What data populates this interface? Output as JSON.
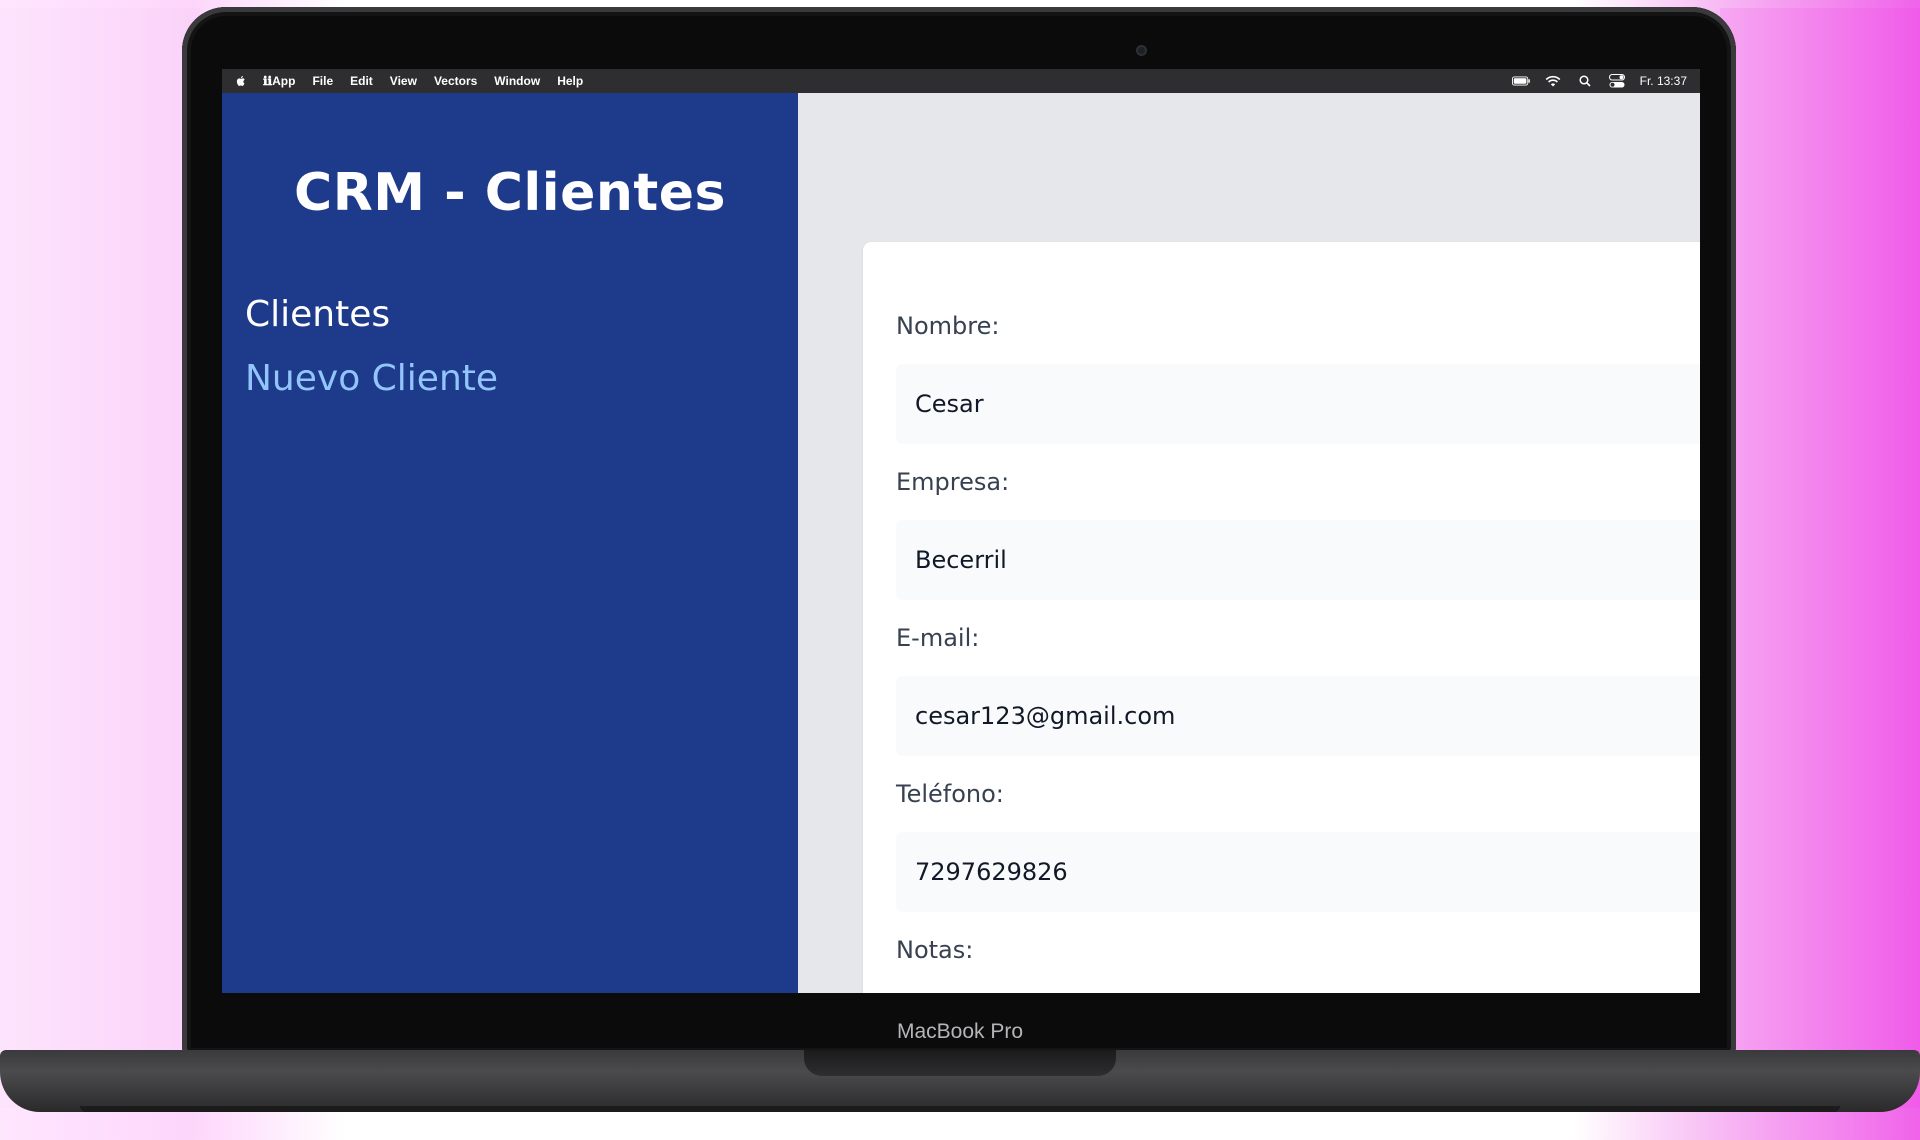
{
  "menubar": {
    "apple_icon": "apple-logo-icon",
    "items": [
      "𝐢𝐢App",
      "File",
      "Edit",
      "View",
      "Vectors",
      "Window",
      "Help"
    ],
    "app_name": "ℹℹApp",
    "file": "File",
    "edit": "Edit",
    "view": "View",
    "vectors": "Vectors",
    "window": "Window",
    "help": "Help",
    "clock": "Fr. 13:37",
    "status_icons": [
      "battery-icon",
      "wifi-icon",
      "search-icon",
      "control-center-icon"
    ]
  },
  "sidebar": {
    "title": "CRM - Clientes",
    "nav": {
      "clientes": "Clientes",
      "nuevo_cliente": "Nuevo Cliente"
    }
  },
  "form": {
    "nombre": {
      "label": "Nombre:",
      "value": "Cesar"
    },
    "empresa": {
      "label": "Empresa:",
      "value": "Becerril"
    },
    "email": {
      "label": "E-mail:",
      "value": "cesar123@gmail.com"
    },
    "telefono": {
      "label": "Teléfono:",
      "value": "7297629826"
    },
    "notas": {
      "label": "Notas:"
    }
  },
  "device": {
    "label": "MacBook Pro"
  },
  "colors": {
    "sidebar_bg": "#1e3a8a",
    "active_link": "#93c5fd",
    "main_bg": "#e5e7eb"
  }
}
